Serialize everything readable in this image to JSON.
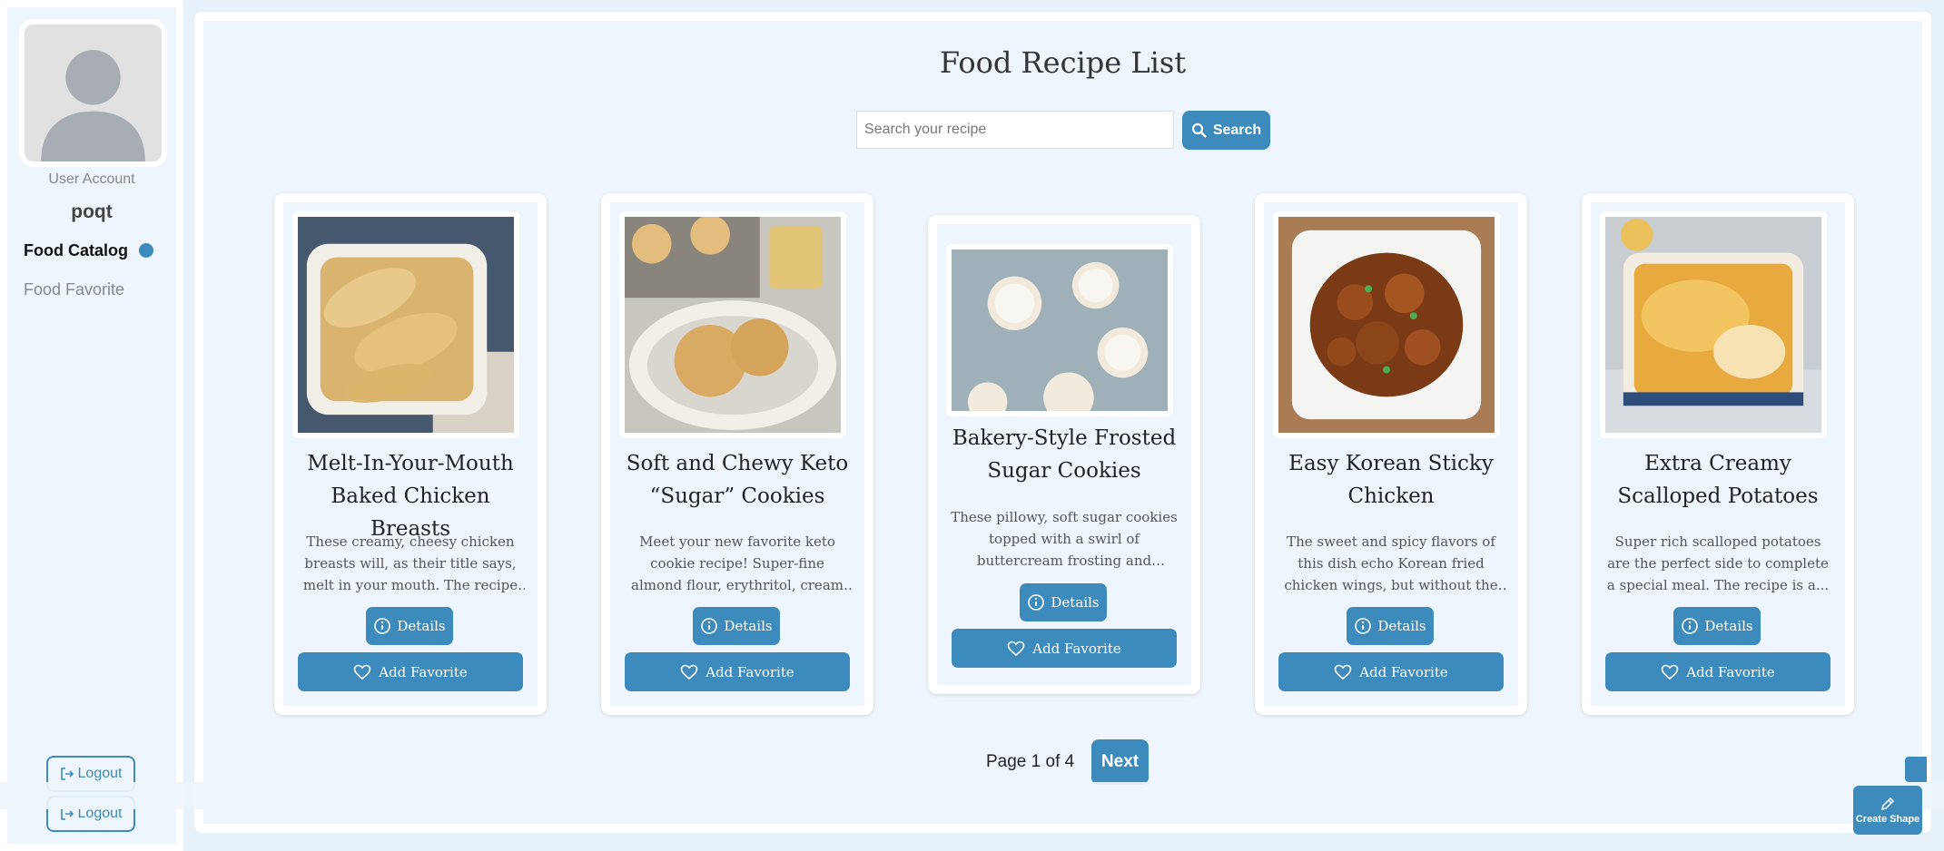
{
  "sidebar": {
    "user_account_label": "User Account",
    "username": "poqt",
    "nav": {
      "catalog": "Food Catalog",
      "favorite": "Food Favorite"
    },
    "logout_label": "Logout"
  },
  "main": {
    "title": "Food Recipe List",
    "search": {
      "placeholder": "Search your recipe",
      "value": "",
      "button_label": "Search"
    }
  },
  "recipes": [
    {
      "title": "Melt-In-Your-Mouth Baked Chicken Breasts",
      "description": "These creamy, cheesy chicken breasts will, as their title says, melt in your mouth. The recipe is ...",
      "details_label": "Details",
      "favorite_label": "Add Favorite"
    },
    {
      "title": "Soft and Chewy Keto “Sugar” Cookies",
      "description": "Meet your new favorite keto cookie recipe! Super-fine almond flour, erythritol, cream cheese...",
      "details_label": "Details",
      "favorite_label": "Add Favorite"
    },
    {
      "title": "Bakery-Style Frosted Sugar Cookies",
      "description": "These pillowy, soft sugar cookies topped with a swirl of buttercream frosting and colorfu...",
      "details_label": "Details",
      "favorite_label": "Add Favorite"
    },
    {
      "title": "Easy Korean Sticky Chicken",
      "description": "The sweet and spicy flavors of this dish echo Korean fried chicken wings, but without the hassle of...",
      "details_label": "Details",
      "favorite_label": "Add Favorite"
    },
    {
      "title": "Extra Creamy Scalloped Potatoes",
      "description": "Super rich scalloped potatoes are the perfect side to complete a special meal. The recipe is a...",
      "details_label": "Details",
      "favorite_label": "Add Favorite"
    }
  ],
  "pagination": {
    "label": "Page 1 of 4",
    "next_label": "Next"
  },
  "create_shape_label": "Create Shape",
  "colors": {
    "accent": "#3d8bbd",
    "background": "#eef5fc"
  }
}
